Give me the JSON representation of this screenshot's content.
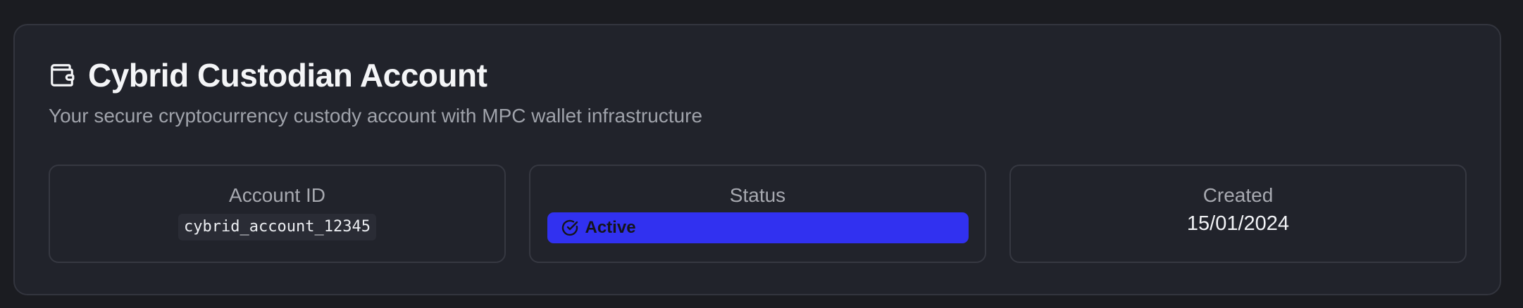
{
  "header": {
    "icon": "wallet-icon",
    "title": "Cybrid Custodian Account",
    "subtitle": "Your secure cryptocurrency custody account with MPC wallet infrastructure"
  },
  "tiles": {
    "account_id": {
      "label": "Account ID",
      "value": "cybrid_account_12345"
    },
    "status": {
      "label": "Status",
      "value": "Active",
      "icon": "check-circle-icon",
      "color": "#3131f0"
    },
    "created": {
      "label": "Created",
      "value": "15/01/2024"
    }
  }
}
